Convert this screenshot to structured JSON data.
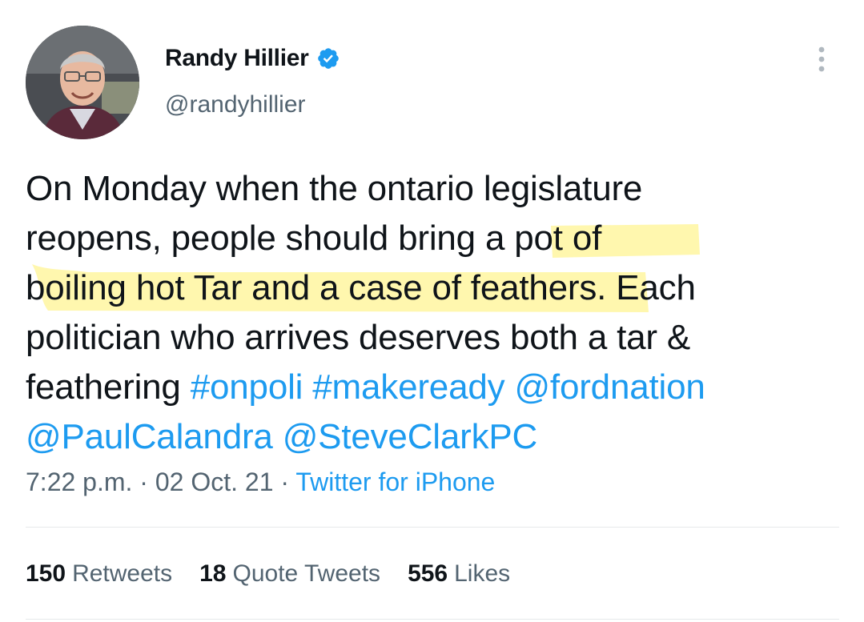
{
  "author": {
    "display_name": "Randy Hillier",
    "handle": "@randyhillier",
    "verified": true,
    "verified_color": "#1d9bf0"
  },
  "tweet": {
    "line1": "On Monday when the ontario legislature",
    "line2": "reopens, people should bring a pot of",
    "line3": "boiling hot Tar and a case of feathers. Each",
    "line4": "politician who arrives deserves both a tar &",
    "line5_text": "feathering ",
    "hashtag1": "#onpoli",
    "hashtag2": "#makeready",
    "mention1": "@fordnation",
    "mention2": "@PaulCalandra",
    "mention3": "@SteveClarkPC",
    "highlight_color": "#fff59d"
  },
  "meta": {
    "time": "7:22 p.m.",
    "separator": "·",
    "date": "02 Oct. 21",
    "source": "Twitter for iPhone"
  },
  "stats": {
    "retweets_count": "150",
    "retweets_label": "Retweets",
    "quotes_count": "18",
    "quotes_label": "Quote Tweets",
    "likes_count": "556",
    "likes_label": "Likes"
  },
  "icons": {
    "more": "more-options-icon",
    "verified": "verified-badge-icon"
  },
  "colors": {
    "text": "#0f1419",
    "secondary": "#536471",
    "link": "#1d9bf0"
  }
}
